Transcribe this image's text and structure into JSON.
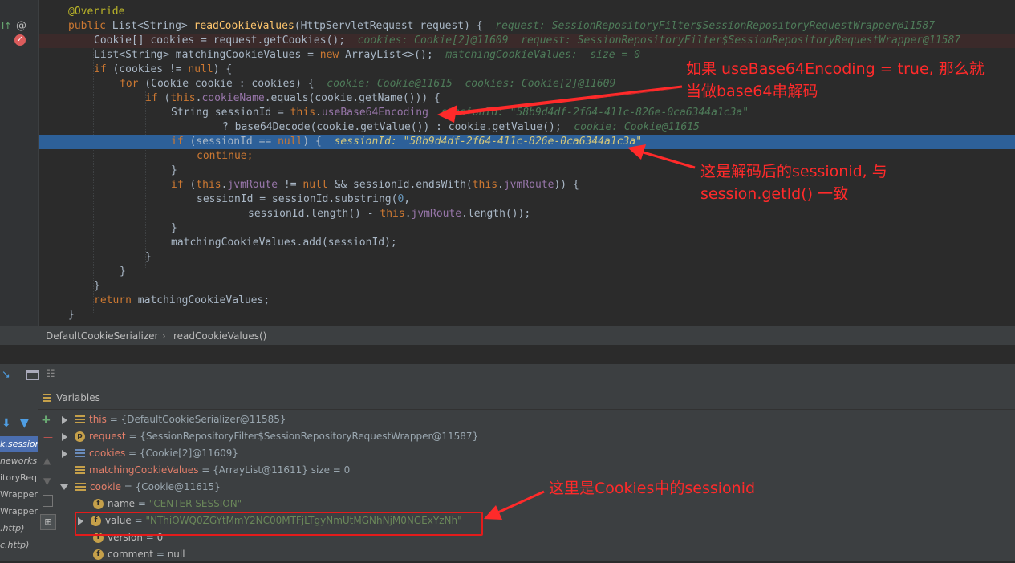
{
  "code": {
    "annotation": "@Override",
    "signature": {
      "kw": "public",
      "ret": "List<String>",
      "name": "readCookieValues",
      "params": "(HttpServletRequest request) {",
      "hint": "request: SessionRepositoryFilter$SessionRepositoryRequestWrapper@11587"
    },
    "l2": {
      "text": "Cookie[] cookies = request.getCookies();",
      "hint": "cookies: Cookie[2]@11609  request: SessionRepositoryFilter$SessionRepositoryRequestWrapper@11587"
    },
    "l3": {
      "a": "List<String> matchingCookieValues = ",
      "kw": "new",
      "b": " ArrayList<>();",
      "hint": "matchingCookieValues:  size = 0"
    },
    "l4": {
      "kw": "if",
      "b": " (cookies != ",
      "kw2": "null",
      "c": ") {"
    },
    "l5": {
      "kw": "for",
      "b": " (Cookie cookie : cookies) {",
      "hint": "cookie: Cookie@11615  cookies: Cookie[2]@11609"
    },
    "l6": {
      "kw": "if",
      "b": " (",
      "kw2": "this",
      "c": ".",
      "fld": "cookieName",
      "d": ".equals(cookie.getName())) {"
    },
    "l7": {
      "a": "String sessionId = ",
      "kw": "this",
      "b": ".",
      "fld": "useBase64Encoding",
      "hint": "sessionId: \"58b9d4df-2f64-411c-826e-0ca6344a1c3a\""
    },
    "l8": {
      "a": "? base64Decode(cookie.getValue()) : cookie.getValue();",
      "hint": "cookie: Cookie@11615"
    },
    "l9": {
      "kw": "if",
      "b": " (sessionId == ",
      "kw2": "null",
      "c": ") {",
      "hint": "sessionId: \"58b9d4df-2f64-411c-826e-0ca6344a1c3a\""
    },
    "l10": {
      "kw": "continue;"
    },
    "l11": "}",
    "l12": {
      "kw": "if",
      "b": " (",
      "kw2": "this",
      "c": ".",
      "fld": "jvmRoute",
      "d": " != ",
      "kw3": "null",
      "e": " && sessionId.endsWith(",
      "kw4": "this",
      "f": ".",
      "fld2": "jvmRoute",
      "g": ")) {"
    },
    "l13": {
      "a": "sessionId = sessionId.substring(",
      "num": "0",
      "b": ","
    },
    "l14": {
      "a": "sessionId.length() - ",
      "kw": "this",
      "b": ".",
      "fld": "jvmRoute",
      "c": ".length());"
    },
    "l15": "}",
    "l16": "matchingCookieValues.add(sessionId);",
    "l17": "}",
    "l18": "}",
    "l19": "}",
    "l20": {
      "kw": "return",
      "b": " matchingCookieValues;"
    },
    "l21": "}"
  },
  "breadcrumb": {
    "class": "DefaultCookieSerializer",
    "sep": "›",
    "method": "readCookieValues()"
  },
  "frames": [
    "k.session",
    "neworks",
    "itoryReq",
    "Wrapper",
    "Wrapper",
    ".http)",
    "c.http)"
  ],
  "variables": {
    "header": "Variables",
    "rows": [
      {
        "name": "this",
        "value": " = {DefaultCookieSerializer@11585}"
      },
      {
        "name": "request",
        "value": " = {SessionRepositoryFilter$SessionRepositoryRequestWrapper@11587}"
      },
      {
        "name": "cookies",
        "value": " = {Cookie[2]@11609}"
      },
      {
        "name": "matchingCookieValues",
        "value": " = {ArrayList@11611}  size = 0"
      },
      {
        "name": "cookie",
        "value": " = {Cookie@11615}"
      },
      {
        "name": "name",
        "eq": " = ",
        "str": "\"CENTER-SESSION\""
      },
      {
        "name": "value",
        "eq": " = ",
        "str": "\"NThiOWQ0ZGYtMmY2NC00MTFjLTgyNmUtMGNhNjM0NGExYzNh\""
      },
      {
        "name": "version",
        "eq": " = ",
        "str": "0"
      },
      {
        "name": "comment",
        "eq": " = ",
        "str": "null"
      }
    ]
  },
  "annotations": {
    "note1_line1": "如果 useBase64Encoding = true, 那么就",
    "note1_line2": "当做base64串解码",
    "note2_line1": "这是解码后的sessionid, 与",
    "note2_line2": "session.getId() 一致",
    "note3": "这里是Cookies中的sessionid"
  },
  "colors": {
    "annotation_red": "#ff2a2a",
    "exec_line": "#2d6099"
  }
}
